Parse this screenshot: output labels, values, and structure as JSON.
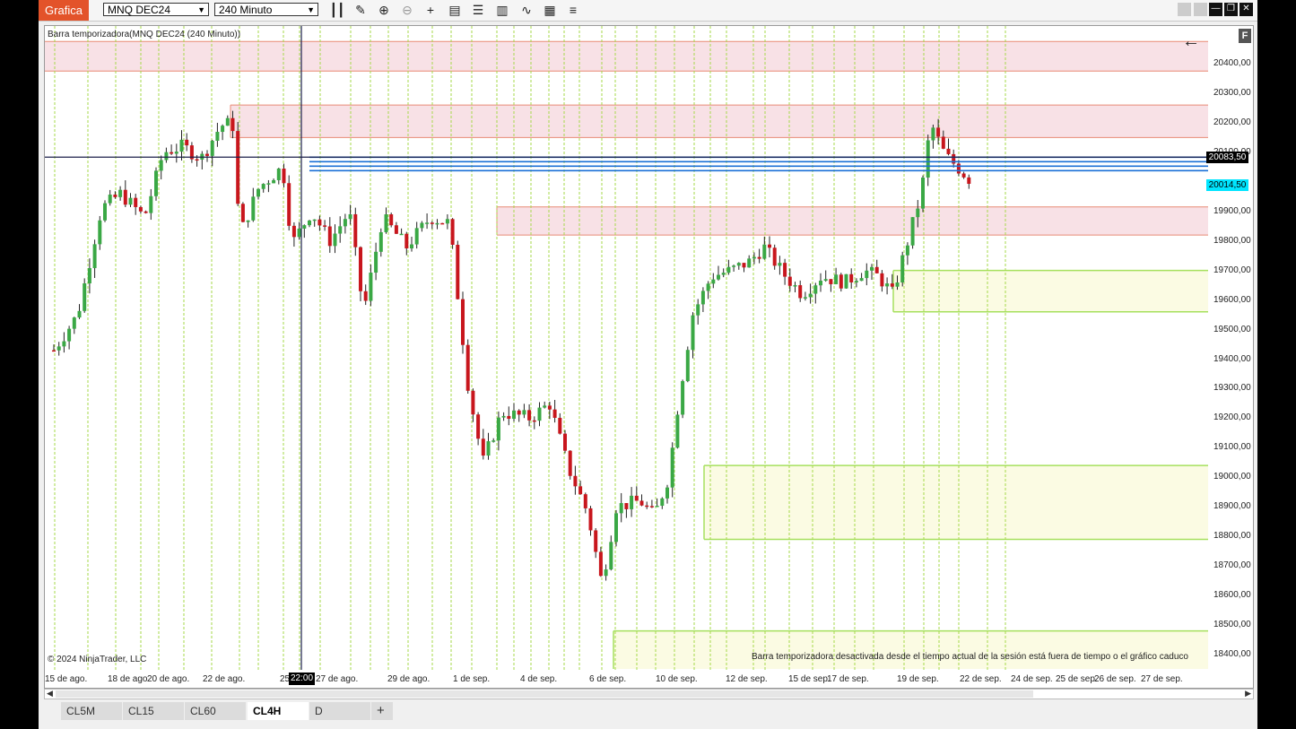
{
  "titlebar": {
    "app_name": "Grafica",
    "instrument": "MNQ DEC24",
    "interval": "240 Minuto",
    "toolbar_icons": [
      "bar-type-icon",
      "draw-tool-icon",
      "zoom-in-icon",
      "zoom-out-icon",
      "crosshair-icon",
      "data-box-icon",
      "chart-trader-icon",
      "properties-icon",
      "indicators-icon",
      "strategies-icon",
      "templates-icon"
    ],
    "window_buttons": [
      "minimize-icon",
      "restore-icon",
      "close-icon"
    ]
  },
  "chart": {
    "title": "Barra temporizadora(MNQ DEC24 (240 Minuto))",
    "copyright": "© 2024 NinjaTrader, LLC",
    "status_message": "Barra temporizadora desactivada desde el tiempo actual de la sesión está fuera de tiempo o el gráfico caduco",
    "crosshair_time": "22:00",
    "crosshair_price_tag": "20083,50",
    "last_price_tag": "20014,50",
    "price_labels": [
      "20400,00",
      "20300,00",
      "20200,00",
      "20100,00",
      "19900,00",
      "19800,00",
      "19700,00",
      "19600,00",
      "19500,00",
      "19400,00",
      "19300,00",
      "19200,00",
      "19100,00",
      "19000,00",
      "18900,00",
      "18800,00",
      "18700,00",
      "18600,00",
      "18500,00",
      "18400,00"
    ],
    "time_labels": [
      "15 de ago.",
      "18 de ago",
      "20 de ago.",
      "22 de ago.",
      "25",
      "27 de ago.",
      "29 de ago.",
      "1 de sep.",
      "4 de sep.",
      "6 de sep.",
      "10 de sep.",
      "12 de sep.",
      "15 de sep.",
      "17 de sep.",
      "19 de sep.",
      "22 de sep.",
      "24 de sep.",
      "25 de sep.",
      "26 de sep.",
      "27 de sep."
    ],
    "colors": {
      "up": "#3aa845",
      "down": "#c8161d",
      "session_line": "#a6d94a",
      "resistance_zone": "#f8e1e6",
      "resistance_line": "#e88a75",
      "support_zone": "#fbfbe3",
      "support_line": "#a6e05e",
      "highlight_line": "#1a6fd6",
      "last_price": "#00e5ff"
    }
  },
  "chart_data": {
    "type": "candlestick",
    "ylim": [
      18350,
      20500
    ],
    "price_unit": "points",
    "candle_count": 180,
    "key_levels": [
      20083.5,
      20014.5
    ],
    "resistance_zones": [
      [
        20375,
        20475
      ],
      [
        20150,
        20260
      ],
      [
        19820,
        19915
      ]
    ],
    "support_zones": [
      [
        19560,
        19700
      ],
      [
        18790,
        19040
      ],
      [
        18350,
        18480
      ]
    ]
  },
  "tabs": [
    "CL5M",
    "CL15",
    "CL60",
    "CL4H",
    "D"
  ],
  "active_tab": "CL4H",
  "add_tab_label": "+"
}
